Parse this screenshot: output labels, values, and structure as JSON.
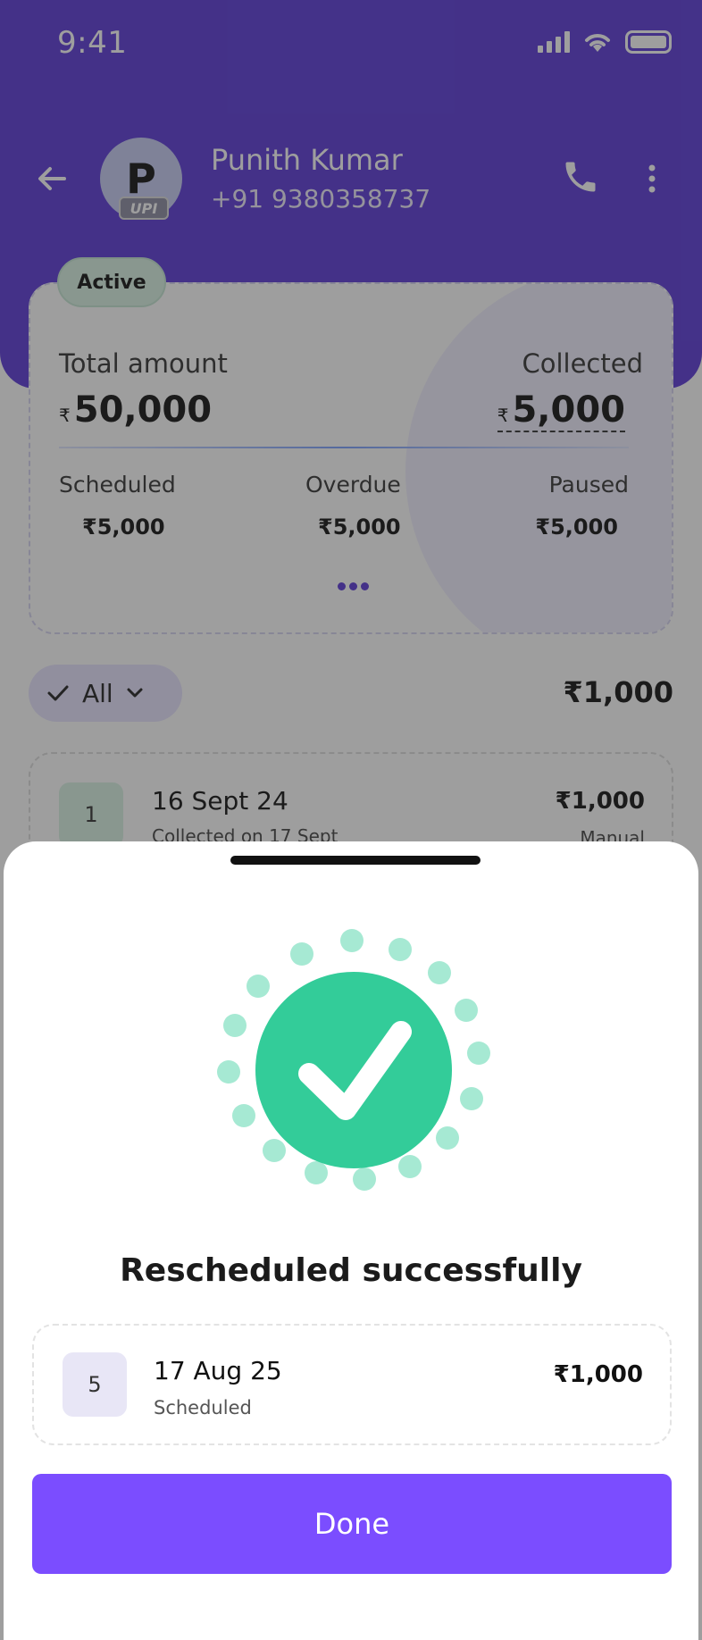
{
  "status_bar": {
    "time": "9:41"
  },
  "contact": {
    "avatar_letter": "P",
    "upi_badge": "UPI",
    "name": "Punith Kumar",
    "phone": "+91 9380358737"
  },
  "summary": {
    "status_pill": "Active",
    "total_label": "Total amount",
    "collected_label": "Collected",
    "currency": "₹",
    "total_amount": "50,000",
    "collected_amount": "5,000",
    "stats": [
      {
        "label": "Scheduled",
        "value": "₹5,000"
      },
      {
        "label": "Overdue",
        "value": "₹5,000"
      },
      {
        "label": "Paused",
        "value": "₹5,000"
      }
    ]
  },
  "filter": {
    "label": "All",
    "total": "₹1,000"
  },
  "installments": [
    {
      "number": "1",
      "date": "16 Sept 24",
      "sub": "Collected on 17 Sept",
      "amount": "₹1,000",
      "mode": "Manual"
    }
  ],
  "sheet": {
    "title": "Rescheduled successfully",
    "item": {
      "number": "5",
      "date": "17 Aug 25",
      "status": "Scheduled",
      "amount": "₹1,000"
    },
    "done_label": "Done"
  },
  "colors": {
    "brand": "#5b3ad8",
    "button": "#7b4dff",
    "success": "#33cc99",
    "success_dots": "#a6e9d3"
  }
}
